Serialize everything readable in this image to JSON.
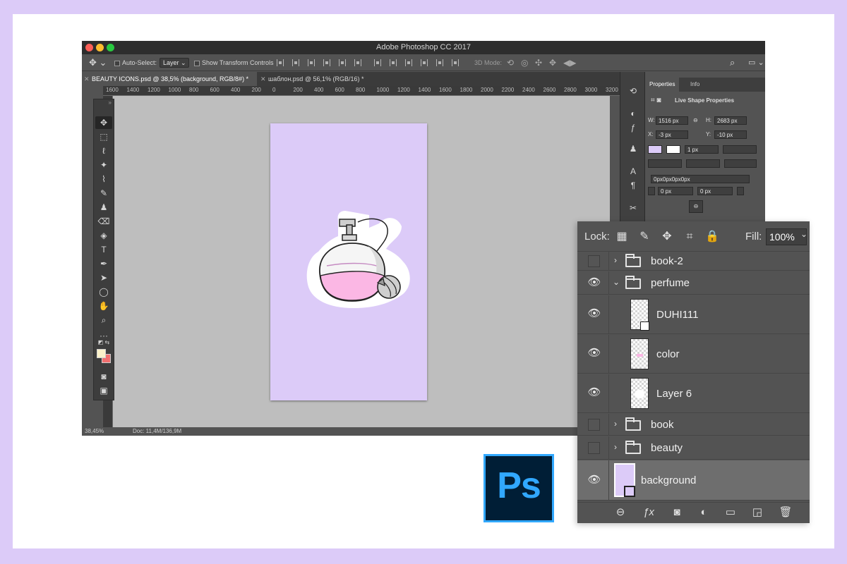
{
  "window": {
    "title": "Adobe Photoshop CC 2017"
  },
  "options_bar": {
    "auto_select_label": "Auto-Select:",
    "auto_select_value": "Layer",
    "show_transform_label": "Show Transform Controls",
    "mode_3d_label": "3D Mode:"
  },
  "tabs": [
    {
      "label": "BEAUTY ICONS.psd @ 38,5% (background, RGB/8#) *",
      "active": true
    },
    {
      "label": "шаблон.psd @ 56,1% (RGB/16) *",
      "active": false
    }
  ],
  "ruler": {
    "ticks": [
      "1600",
      "1400",
      "1200",
      "1000",
      "800",
      "600",
      "400",
      "200",
      "0",
      "200",
      "400",
      "600",
      "800",
      "1000",
      "1200",
      "1400",
      "1600",
      "1800",
      "2000",
      "2200",
      "2400",
      "2600",
      "2800",
      "3000",
      "3200"
    ]
  },
  "status": {
    "zoom": "38,45%",
    "doc": "Doc: 11,4M/136,9M"
  },
  "properties": {
    "tabs": [
      "Properties",
      "Info"
    ],
    "section_title": "Live Shape Properties",
    "w_label": "W:",
    "w_value": "1516 px",
    "h_label": "H:",
    "h_value": "2683 px",
    "x_label": "X:",
    "x_value": "-3 px",
    "y_label": "Y:",
    "y_value": "-10 px",
    "stroke_width": "1 px",
    "radius_text": "0px0px0px0px",
    "corner_left": "0 px",
    "corner_right": "0 px",
    "fill_swatch_color": "#dccbf8"
  },
  "layers": {
    "lock_label": "Lock:",
    "fill_label": "Fill:",
    "fill_value": "100%",
    "items": [
      {
        "name": "book-2",
        "type": "group",
        "visible": false,
        "expanded": false
      },
      {
        "name": "perfume",
        "type": "group",
        "visible": true,
        "expanded": true
      },
      {
        "name": "DUHI111",
        "type": "smart",
        "visible": true
      },
      {
        "name": "color",
        "type": "pixel",
        "visible": true
      },
      {
        "name": "Layer 6",
        "type": "pixel",
        "visible": true
      },
      {
        "name": "book",
        "type": "group",
        "visible": false,
        "expanded": false
      },
      {
        "name": "beauty",
        "type": "group",
        "visible": false,
        "expanded": false
      },
      {
        "name": "background",
        "type": "shape",
        "visible": true,
        "selected": true,
        "swatch": "#dccbf8"
      }
    ]
  },
  "logo": {
    "text": "Ps"
  },
  "colors": {
    "page_bg": "#dccbf8",
    "artboard": "#dccbf8",
    "perfume_liquid": "#fbb7e4",
    "foreground": "#fbf1c9",
    "background_swatch": "#f16f6f",
    "logo_bg": "#001e36",
    "logo_accent": "#31a8ff"
  }
}
